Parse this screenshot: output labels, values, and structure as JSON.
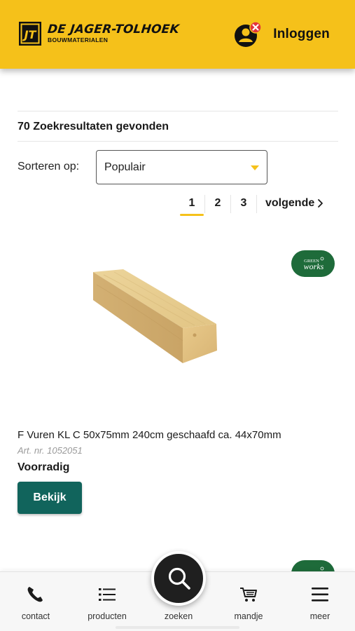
{
  "header": {
    "brand_name": "DE JAGER-TOLHOEK",
    "brand_sub": "BOUWMATERIALEN",
    "logo_mark": "JT",
    "login_label": "Inloggen",
    "login_icon": "user-icon",
    "login_status_icon": "close-icon"
  },
  "results": {
    "count_text": "70 Zoekresultaten gevonden"
  },
  "sort": {
    "label": "Sorteren op:",
    "selected": "Populair"
  },
  "pagination": {
    "pages": [
      "1",
      "2",
      "3"
    ],
    "active_page": "1",
    "next_label": "volgende"
  },
  "product": {
    "badge": "GREEN works",
    "title": "F Vuren KL C 50x75mm 240cm geschaafd ca. 44x70mm",
    "sku": "Art. nr. 1052051",
    "stock": "Voorradig",
    "button_label": "Bekijk"
  },
  "bottom_nav": {
    "items": [
      {
        "label": "contact",
        "icon": "phone-icon"
      },
      {
        "label": "producten",
        "icon": "list-icon"
      },
      {
        "label": "zoeken",
        "icon": "search-icon"
      },
      {
        "label": "mandje",
        "icon": "cart-icon"
      },
      {
        "label": "meer",
        "icon": "menu-icon"
      }
    ]
  },
  "colors": {
    "brand_yellow": "#f5c11a",
    "button_teal": "#11645c",
    "badge_green": "#1e6b3a",
    "alert_red": "#e2343a"
  }
}
